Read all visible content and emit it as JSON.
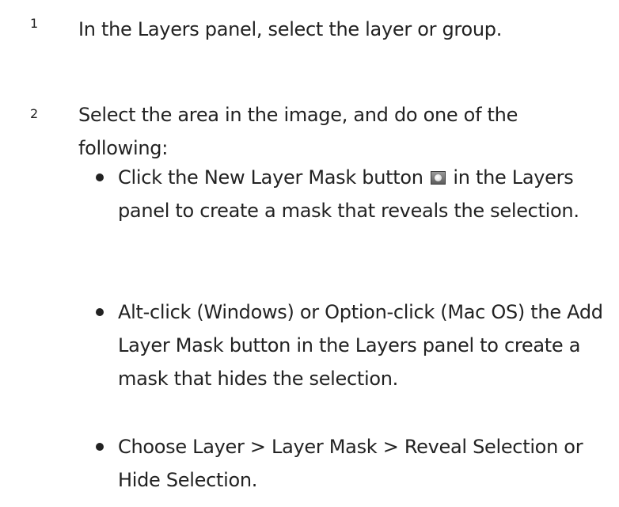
{
  "steps": [
    {
      "number": "1",
      "text": "In the Layers panel, select the layer or group."
    },
    {
      "number": "2",
      "text": "Select the area in the image, and do one of the following:",
      "options": [
        {
          "before": "Click the New Layer Mask button",
          "icon": "layer-mask-icon",
          "after": "in the Layers panel to create a mask that reveals the selection."
        },
        {
          "text": "Alt-click (Windows) or Option-click (Mac OS) the Add Layer Mask button in the Layers panel to create a mask that hides the selection."
        },
        {
          "text": "Choose Layer > Layer Mask > Reveal Selection or Hide Selection."
        }
      ]
    }
  ]
}
